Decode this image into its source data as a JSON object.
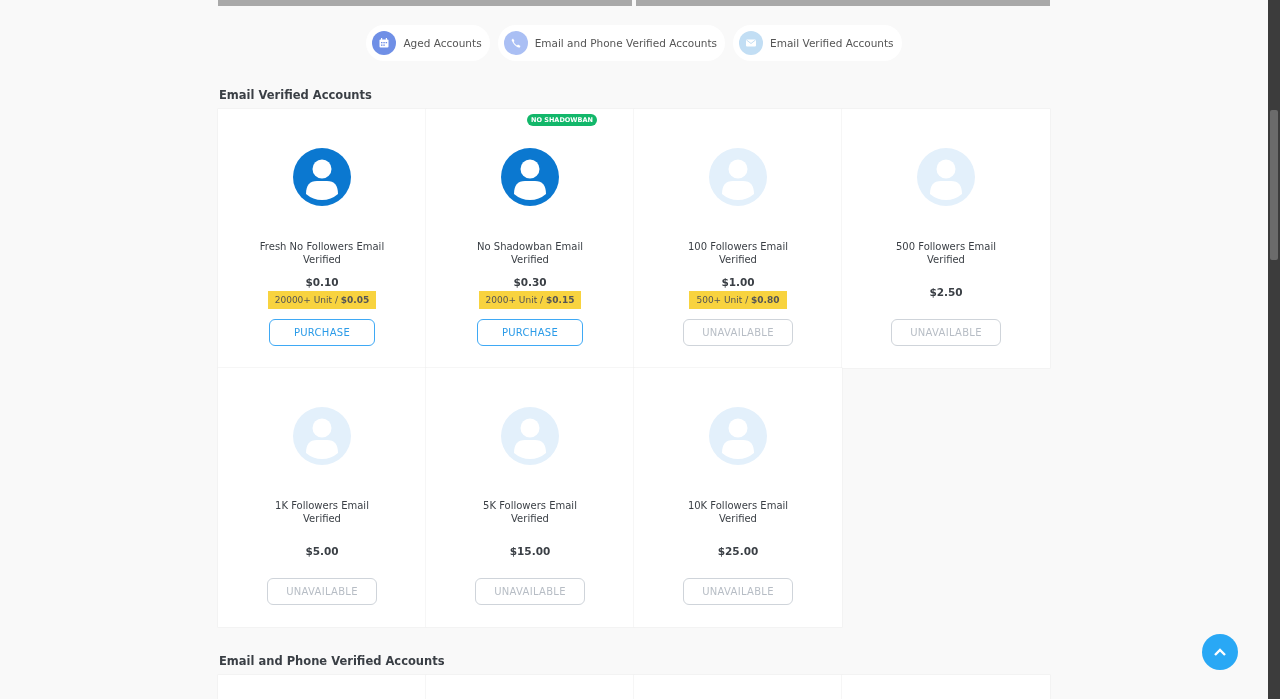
{
  "category_tabs": [
    {
      "label": "Aged Accounts",
      "kind": "calendar",
      "color": "#6f8fe6"
    },
    {
      "label": "Email and Phone Verified Accounts",
      "kind": "phone",
      "color": "#aabff4"
    },
    {
      "label": "Email Verified Accounts",
      "kind": "mail",
      "color": "#c2def4"
    }
  ],
  "sections": [
    {
      "title": "Email Verified Accounts",
      "products": [
        {
          "name": "Fresh No Followers Email Verified",
          "price": "$0.10",
          "tier": "20000+ Unit / **$0.05**",
          "available": true,
          "button": "PURCHASE"
        },
        {
          "name": "No Shadowban Email Verified",
          "badge": "NO SHADOWBAN",
          "price": "$0.30",
          "tier": "2000+ Unit / **$0.15**",
          "available": true,
          "button": "PURCHASE"
        },
        {
          "name": "100 Followers Email Verified",
          "price": "$1.00",
          "tier": "500+ Unit / **$0.80**",
          "available": false,
          "button": "UNAVAILABLE"
        },
        {
          "name": "500 Followers Email Verified",
          "price": "$2.50",
          "available": false,
          "button": "UNAVAILABLE"
        },
        {
          "name": "1K Followers Email Verified",
          "price": "$5.00",
          "available": false,
          "button": "UNAVAILABLE"
        },
        {
          "name": "5K Followers Email Verified",
          "price": "$15.00",
          "available": false,
          "button": "UNAVAILABLE"
        },
        {
          "name": "10K Followers Email Verified",
          "price": "$25.00",
          "available": false,
          "button": "UNAVAILABLE"
        }
      ]
    },
    {
      "title": "Email and Phone Verified Accounts"
    }
  ]
}
